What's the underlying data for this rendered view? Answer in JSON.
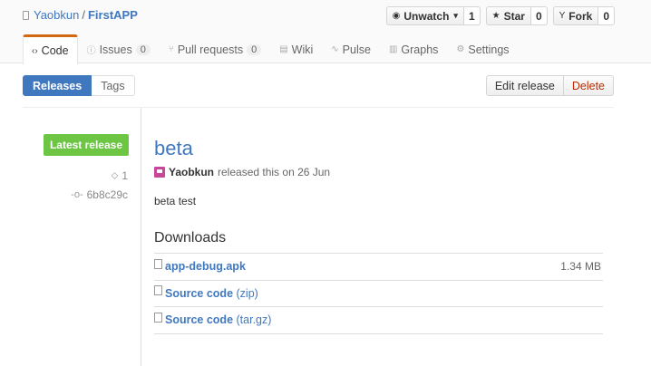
{
  "repo": {
    "owner": "Yaobkun",
    "separator": "/",
    "name": "FirstAPP"
  },
  "actions": [
    {
      "icon": "eye-icon",
      "glyph": "◉",
      "label": "Unwatch",
      "caret": "▾",
      "count": "1"
    },
    {
      "icon": "star-icon",
      "glyph": "★",
      "label": "Star",
      "count": "0"
    },
    {
      "icon": "fork-icon",
      "glyph": "Y",
      "label": "Fork",
      "count": "0"
    }
  ],
  "tabs": [
    {
      "glyph": "‹›",
      "label": "Code",
      "count": ""
    },
    {
      "glyph": "ⓘ",
      "label": "Issues",
      "count": "0"
    },
    {
      "glyph": "⑂",
      "label": "Pull requests",
      "count": "0"
    },
    {
      "glyph": "▤",
      "label": "Wiki",
      "count": ""
    },
    {
      "glyph": "∿",
      "label": "Pulse",
      "count": ""
    },
    {
      "glyph": "▥",
      "label": "Graphs",
      "count": ""
    },
    {
      "glyph": "⚙",
      "label": "Settings",
      "count": ""
    }
  ],
  "subnav": {
    "releases": "Releases",
    "tags": "Tags"
  },
  "release_actions": {
    "edit": "Edit release",
    "delete": "Delete"
  },
  "release": {
    "latest_label": "Latest release",
    "tag": "1",
    "commit": "6b8c29c",
    "title": "beta",
    "author": "Yaobkun",
    "released_text": "released this on 26 Jun",
    "body": "beta test",
    "downloads_title": "Downloads",
    "downloads": [
      {
        "name": "app-debug.apk",
        "ext": "",
        "size": "1.34 MB"
      },
      {
        "name": "Source code",
        "ext": " (zip)",
        "size": ""
      },
      {
        "name": "Source code",
        "ext": " (tar.gz)",
        "size": ""
      }
    ]
  },
  "colors": {
    "link": "#4078c0",
    "accent_tab": "#d26911",
    "latest_green": "#6cc644",
    "danger": "#bd2c00"
  }
}
